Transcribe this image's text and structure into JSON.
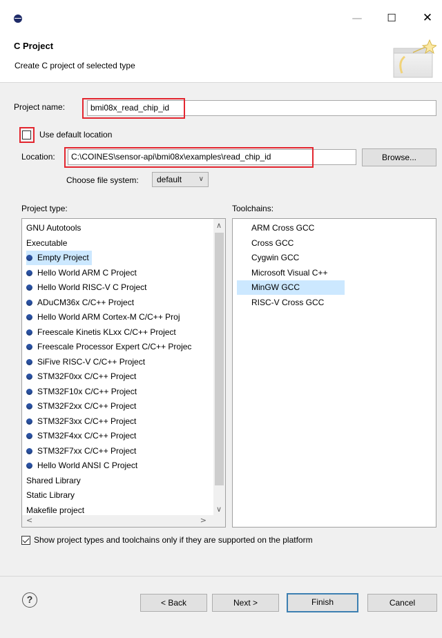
{
  "window": {
    "minimize": "—",
    "maximize": "☐",
    "close": "✕"
  },
  "header": {
    "title": "C Project",
    "description": "Create C project of selected type"
  },
  "form": {
    "project_name_label": "Project name:",
    "project_name_value": "bmi08x_read_chip_id",
    "use_default_location_label": "Use default location",
    "use_default_location_checked": false,
    "location_label": "Location:",
    "location_value": "C:\\COINES\\sensor-api\\bmi08x\\examples\\read_chip_id",
    "browse_label": "Browse...",
    "file_system_label": "Choose file system:",
    "file_system_value": "default"
  },
  "project_types": {
    "heading": "Project type:",
    "items": [
      {
        "label": "GNU Autotools",
        "bullet": false,
        "selected": false
      },
      {
        "label": "Executable",
        "bullet": false,
        "selected": false
      },
      {
        "label": "Empty Project",
        "bullet": true,
        "selected": true
      },
      {
        "label": "Hello World ARM C Project",
        "bullet": true,
        "selected": false
      },
      {
        "label": "Hello World RISC-V C Project",
        "bullet": true,
        "selected": false
      },
      {
        "label": "ADuCM36x C/C++ Project",
        "bullet": true,
        "selected": false
      },
      {
        "label": "Hello World ARM Cortex-M C/C++ Proj",
        "bullet": true,
        "selected": false
      },
      {
        "label": "Freescale Kinetis KLxx C/C++ Project",
        "bullet": true,
        "selected": false
      },
      {
        "label": "Freescale Processor Expert C/C++ Projec",
        "bullet": true,
        "selected": false
      },
      {
        "label": "SiFive RISC-V C/C++ Project",
        "bullet": true,
        "selected": false
      },
      {
        "label": "STM32F0xx C/C++ Project",
        "bullet": true,
        "selected": false
      },
      {
        "label": "STM32F10x C/C++ Project",
        "bullet": true,
        "selected": false
      },
      {
        "label": "STM32F2xx C/C++ Project",
        "bullet": true,
        "selected": false
      },
      {
        "label": "STM32F3xx C/C++ Project",
        "bullet": true,
        "selected": false
      },
      {
        "label": "STM32F4xx C/C++ Project",
        "bullet": true,
        "selected": false
      },
      {
        "label": "STM32F7xx C/C++ Project",
        "bullet": true,
        "selected": false
      },
      {
        "label": "Hello World ANSI C Project",
        "bullet": true,
        "selected": false
      },
      {
        "label": "Shared Library",
        "bullet": false,
        "selected": false
      },
      {
        "label": "Static Library",
        "bullet": false,
        "selected": false
      },
      {
        "label": "Makefile project",
        "bullet": false,
        "selected": false
      }
    ]
  },
  "toolchains": {
    "heading": "Toolchains:",
    "items": [
      {
        "label": "ARM Cross GCC",
        "selected": false
      },
      {
        "label": "Cross GCC",
        "selected": false
      },
      {
        "label": "Cygwin GCC",
        "selected": false
      },
      {
        "label": "Microsoft Visual C++",
        "selected": false
      },
      {
        "label": "MinGW GCC",
        "selected": true
      },
      {
        "label": "RISC-V Cross GCC",
        "selected": false
      }
    ]
  },
  "filter": {
    "label": "Show project types and toolchains only if they are supported on the platform",
    "checked": true
  },
  "footer": {
    "help": "?",
    "back": "< Back",
    "next": "Next >",
    "finish": "Finish",
    "cancel": "Cancel"
  },
  "colors": {
    "highlight_box": "#e3262f",
    "selection": "#cce8ff",
    "bullet": "#2b53a4",
    "default_button_border": "#3c7fb1"
  }
}
